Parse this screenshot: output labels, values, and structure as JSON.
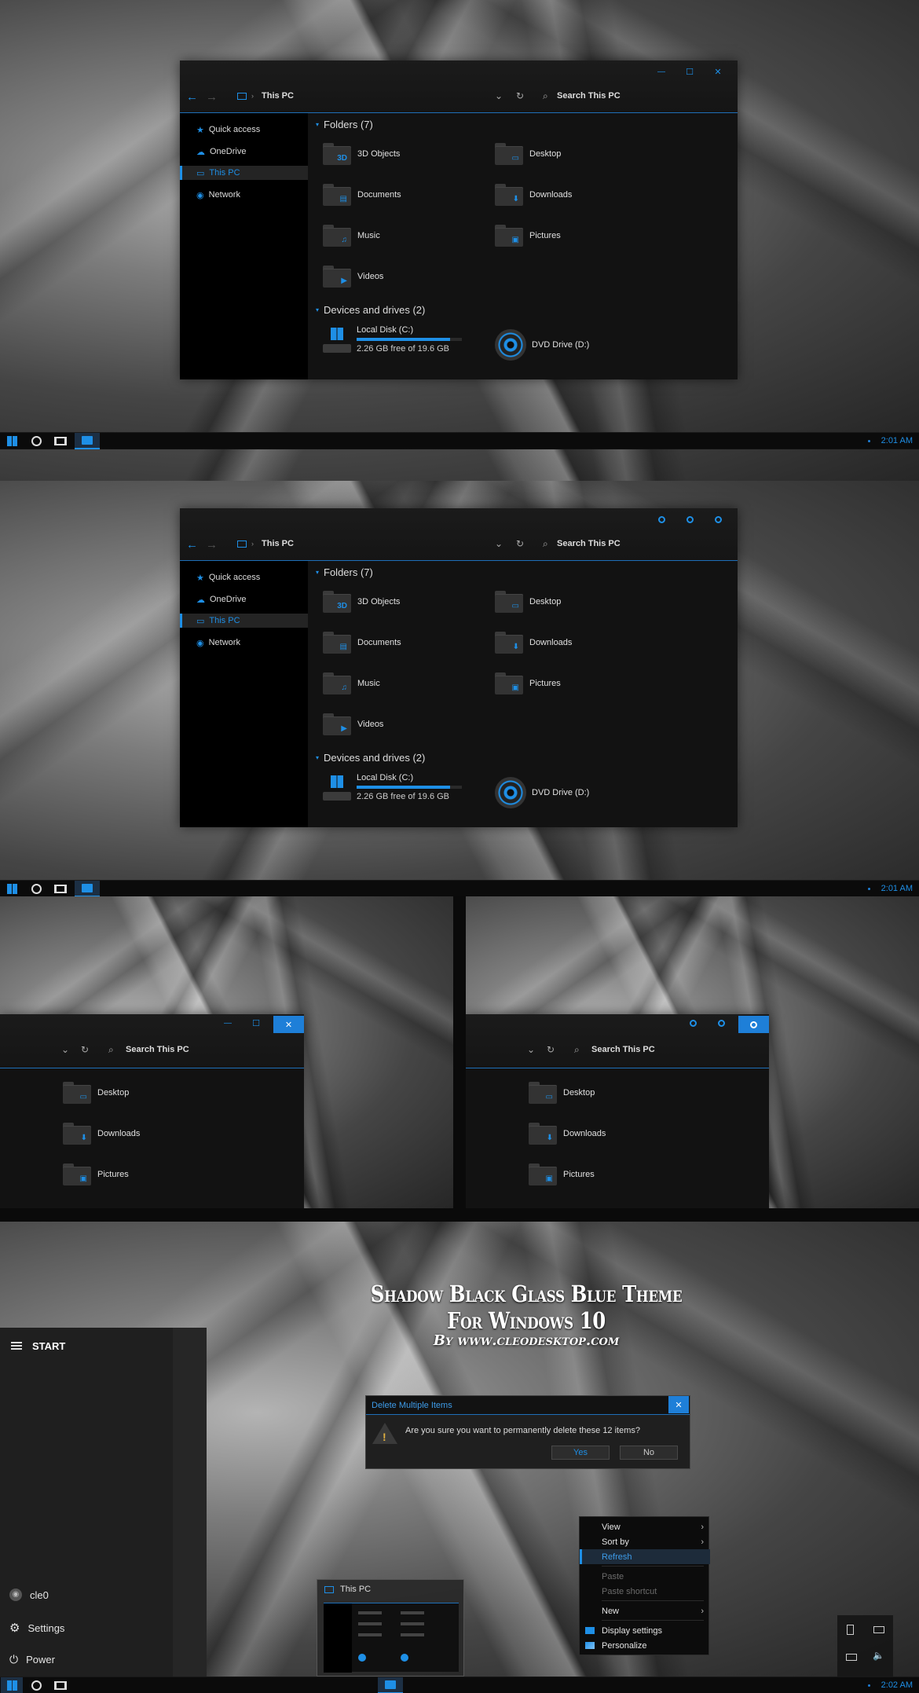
{
  "colors": {
    "accent": "#1e8fe6",
    "window_bg": "#121212",
    "sidebar_bg": "#000000",
    "taskbar_bg": "#0b0b0b"
  },
  "explorer": {
    "location": "This PC",
    "search_placeholder": "Search This PC",
    "nav": [
      "Quick access",
      "OneDrive",
      "This PC",
      "Network"
    ],
    "folders_header": "Folders (7)",
    "folders": [
      {
        "name": "3D Objects",
        "icon": "3d-objects-icon"
      },
      {
        "name": "Desktop",
        "icon": "desktop-folder-icon"
      },
      {
        "name": "Documents",
        "icon": "documents-folder-icon"
      },
      {
        "name": "Downloads",
        "icon": "downloads-folder-icon"
      },
      {
        "name": "Music",
        "icon": "music-folder-icon"
      },
      {
        "name": "Pictures",
        "icon": "pictures-folder-icon"
      },
      {
        "name": "Videos",
        "icon": "videos-folder-icon"
      }
    ],
    "devices_header": "Devices and drives (2)",
    "drives": [
      {
        "name": "Local Disk (C:)",
        "free": "2.26 GB free of 19.6 GB",
        "used_fraction": 0.885
      },
      {
        "name": "DVD Drive (D:)"
      }
    ]
  },
  "taskbar": {
    "clock1": "2:01 AM",
    "clock2": "2:01 AM",
    "clock3": "2:02 AM"
  },
  "caption": {
    "minimize": "—",
    "maximize": "☐",
    "close": "✕"
  },
  "promo": {
    "title": "Shadow Black Glass Blue Theme For Windows 10",
    "subtitle": "By www.cleodesktop.com"
  },
  "start_menu": {
    "title": "START",
    "user": "cle0",
    "settings": "Settings",
    "power": "Power"
  },
  "dialog": {
    "title": "Delete Multiple Items",
    "message": "Are you sure you want to permanently delete these 12 items?",
    "yes": "Yes",
    "no": "No",
    "close": "✕"
  },
  "context_menu": [
    "View",
    "Sort by",
    "Refresh",
    "Paste",
    "Paste shortcut",
    "New",
    "Display settings",
    "Personalize"
  ],
  "thumbnail": {
    "title": "This PC"
  }
}
